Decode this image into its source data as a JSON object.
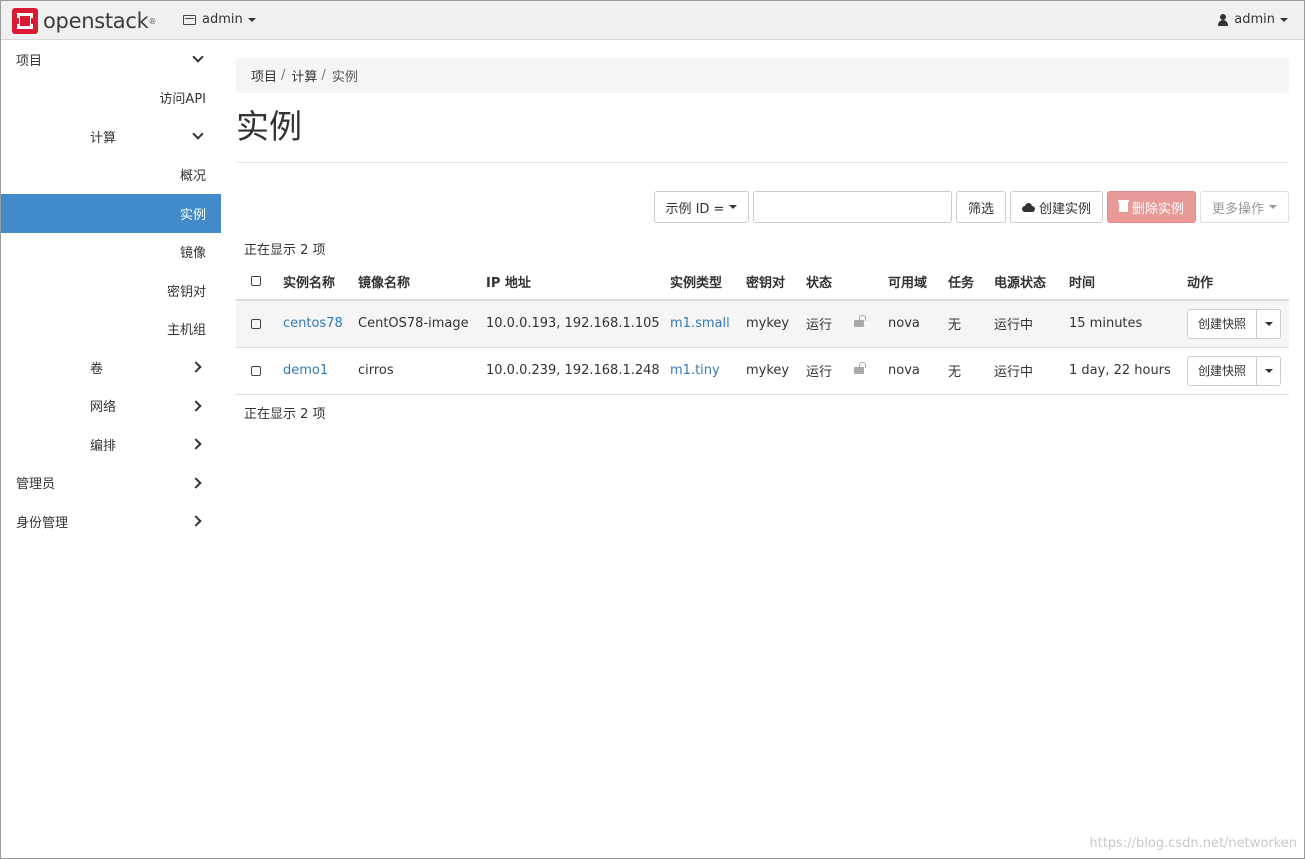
{
  "topbar": {
    "brand": "openstack",
    "brand_reg": "®",
    "project": "admin",
    "user": "admin"
  },
  "sidebar": {
    "items": [
      {
        "label": "项目"
      },
      {
        "label": "访问API"
      },
      {
        "label": "计算"
      },
      {
        "label": "概况"
      },
      {
        "label": "实例"
      },
      {
        "label": "镜像"
      },
      {
        "label": "密钥对"
      },
      {
        "label": "主机组"
      },
      {
        "label": "卷"
      },
      {
        "label": "网络"
      },
      {
        "label": "编排"
      },
      {
        "label": "管理员"
      },
      {
        "label": "身份管理"
      }
    ]
  },
  "breadcrumb": [
    "项目",
    "计算",
    "实例"
  ],
  "breadcrumb_sep": "/",
  "page_title": "实例",
  "toolbar": {
    "filter_field": "示例 ID =",
    "filter_value": "",
    "filter_button": "筛选",
    "create_button": "创建实例",
    "delete_button": "删除实例",
    "more_button": "更多操作"
  },
  "count_text": "正在显示 2 项",
  "table": {
    "headers": [
      "实例名称",
      "镜像名称",
      "IP 地址",
      "实例类型",
      "密钥对",
      "状态",
      "可用域",
      "任务",
      "电源状态",
      "时间",
      "动作"
    ],
    "rows": [
      {
        "name": "centos78",
        "image": "CentOS78-image",
        "ip": "10.0.0.193, 192.168.1.105",
        "flavor": "m1.small",
        "keypair": "mykey",
        "status": "运行",
        "zone": "nova",
        "task": "无",
        "power": "运行中",
        "age": "15 minutes",
        "action": "创建快照"
      },
      {
        "name": "demo1",
        "image": "cirros",
        "ip": "10.0.0.239, 192.168.1.248",
        "flavor": "m1.tiny",
        "keypair": "mykey",
        "status": "运行",
        "zone": "nova",
        "task": "无",
        "power": "运行中",
        "age": "1 day, 22 hours",
        "action": "创建快照"
      }
    ]
  },
  "watermark": "https://blog.csdn.net/networken"
}
